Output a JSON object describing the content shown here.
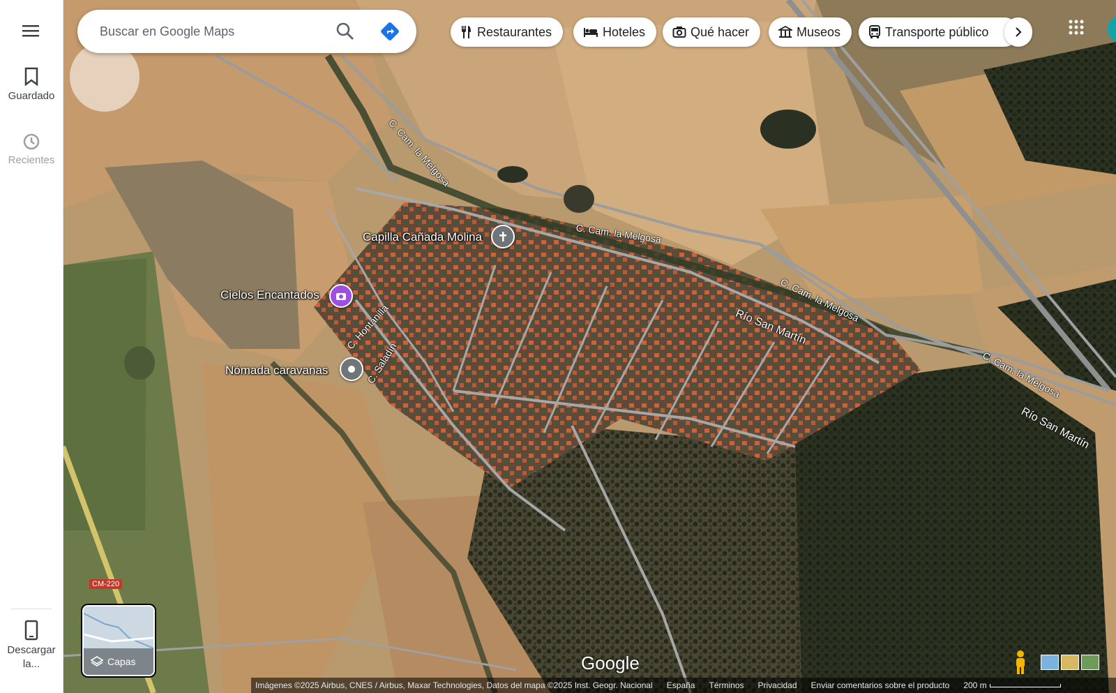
{
  "sidebar": {
    "saved_label": "Guardado",
    "recent_label": "Recientes",
    "download_label": "Descargar la..."
  },
  "search": {
    "placeholder": "Buscar en Google Maps"
  },
  "chips": [
    {
      "label": "Restaurantes",
      "icon": "fork-knife-icon"
    },
    {
      "label": "Hoteles",
      "icon": "bed-icon"
    },
    {
      "label": "Qué hacer",
      "icon": "camera-icon"
    },
    {
      "label": "Museos",
      "icon": "museum-icon"
    },
    {
      "label": "Transporte público",
      "icon": "bus-icon"
    }
  ],
  "places": {
    "chapel": "Capilla Cañada Molina",
    "cielos": "Cielos Encantados",
    "nomada": "Nómada caravanas"
  },
  "roads": {
    "melgosa_1": "C. Cam. la Melgosa",
    "melgosa_2": "C. Cam. la Melgosa",
    "melgosa_3": "C. Cam. la Melgosa",
    "melgosa_4": "C. Cam. la Melgosa",
    "rio_1": "Río San Martín",
    "rio_2": "Río San Martín",
    "hontanilla": "C. Hontanilla",
    "saladin": "C. Saladín",
    "cm220": "CM-220"
  },
  "layers": {
    "label": "Capas"
  },
  "logo": "Google",
  "footer": {
    "attribution": "Imágenes ©2025 Airbus, CNES / Airbus, Maxar Technologies, Datos del mapa ©2025 Inst. Geogr. Nacional",
    "country": "España",
    "terms": "Términos",
    "privacy": "Privacidad",
    "feedback": "Enviar comentarios sobre el producto",
    "scale": "200 m"
  },
  "colors": {
    "direction_blue": "#1a73e8",
    "pin_purple": "#9c4fe0",
    "pin_gray": "#70757a"
  }
}
